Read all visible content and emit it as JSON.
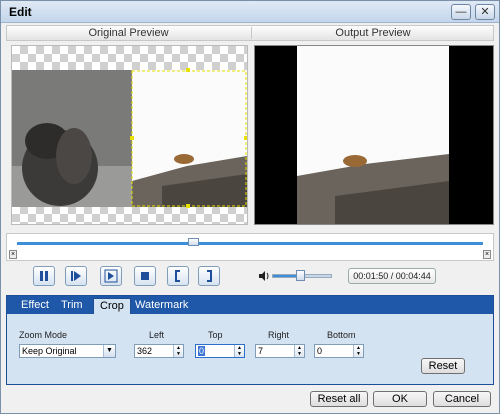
{
  "window": {
    "title": "Edit",
    "minimize_label": "—",
    "close_label": "✕"
  },
  "preview": {
    "original_label": "Original Preview",
    "output_label": "Output Preview"
  },
  "timeline": {
    "position_fraction": 0.37,
    "start_mark": "×",
    "end_mark": "×"
  },
  "playback": {
    "buttons": [
      "pause",
      "step-forward",
      "frame-forward",
      "stop",
      "mark-in",
      "mark-out"
    ],
    "volume_fraction": 0.45,
    "time": "00:01:50 / 00:04:44"
  },
  "tabs": [
    {
      "label": "Effect",
      "active": false
    },
    {
      "label": "Trim",
      "active": false
    },
    {
      "label": "Crop",
      "active": true
    },
    {
      "label": "Watermark",
      "active": false
    }
  ],
  "crop": {
    "zoom_mode_label": "Zoom Mode",
    "zoom_mode_value": "Keep Original",
    "left_label": "Left",
    "left_value": "362",
    "top_label": "Top",
    "top_value": "0",
    "right_label": "Right",
    "right_value": "7",
    "bottom_label": "Bottom",
    "bottom_value": "0",
    "reset_label": "Reset"
  },
  "footer": {
    "reset_all_label": "Reset all",
    "ok_label": "OK",
    "cancel_label": "Cancel"
  }
}
